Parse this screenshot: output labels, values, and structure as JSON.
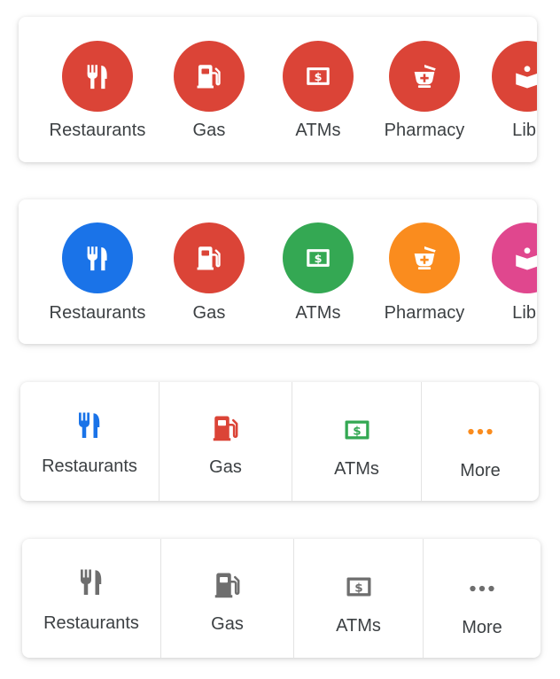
{
  "colors": {
    "red": "#DB4437",
    "blue": "#1A73E8",
    "green": "#34A853",
    "orange": "#FA8C1E",
    "pink": "#E0478E",
    "grey": "#6E6E6E",
    "label": "#3C4043"
  },
  "row1": {
    "style": "all-red-circles",
    "items": [
      {
        "label": "Restaurants",
        "icon": "fork-knife-icon",
        "color": "#DB4437"
      },
      {
        "label": "Gas",
        "icon": "gas-pump-icon",
        "color": "#DB4437"
      },
      {
        "label": "ATMs",
        "icon": "atm-dollar-icon",
        "color": "#DB4437"
      },
      {
        "label": "Pharmacy",
        "icon": "pharmacy-mortar-icon",
        "color": "#DB4437"
      },
      {
        "label": "Libr",
        "icon": "library-book-icon",
        "color": "#DB4437"
      }
    ]
  },
  "row2": {
    "style": "colored-circles",
    "items": [
      {
        "label": "Restaurants",
        "icon": "fork-knife-icon",
        "color": "#1A73E8"
      },
      {
        "label": "Gas",
        "icon": "gas-pump-icon",
        "color": "#DB4437"
      },
      {
        "label": "ATMs",
        "icon": "atm-dollar-icon",
        "color": "#34A853"
      },
      {
        "label": "Pharmacy",
        "icon": "pharmacy-mortar-icon",
        "color": "#FA8C1E"
      },
      {
        "label": "Libr",
        "icon": "library-book-icon",
        "color": "#E0478E"
      }
    ]
  },
  "row3": {
    "style": "colored-tiles",
    "items": [
      {
        "label": "Restaurants",
        "icon": "fork-knife-icon",
        "color": "#1A73E8"
      },
      {
        "label": "Gas",
        "icon": "gas-pump-icon",
        "color": "#DB4437"
      },
      {
        "label": "ATMs",
        "icon": "atm-dollar-icon",
        "color": "#34A853"
      },
      {
        "label": "More",
        "icon": "more-dots-icon",
        "color": "#FA8C1E"
      }
    ]
  },
  "row4": {
    "style": "grey-tiles",
    "items": [
      {
        "label": "Restaurants",
        "icon": "fork-knife-icon",
        "color": "#6E6E6E"
      },
      {
        "label": "Gas",
        "icon": "gas-pump-icon",
        "color": "#6E6E6E"
      },
      {
        "label": "ATMs",
        "icon": "atm-dollar-icon",
        "color": "#6E6E6E"
      },
      {
        "label": "More",
        "icon": "more-dots-icon",
        "color": "#6E6E6E"
      }
    ]
  }
}
